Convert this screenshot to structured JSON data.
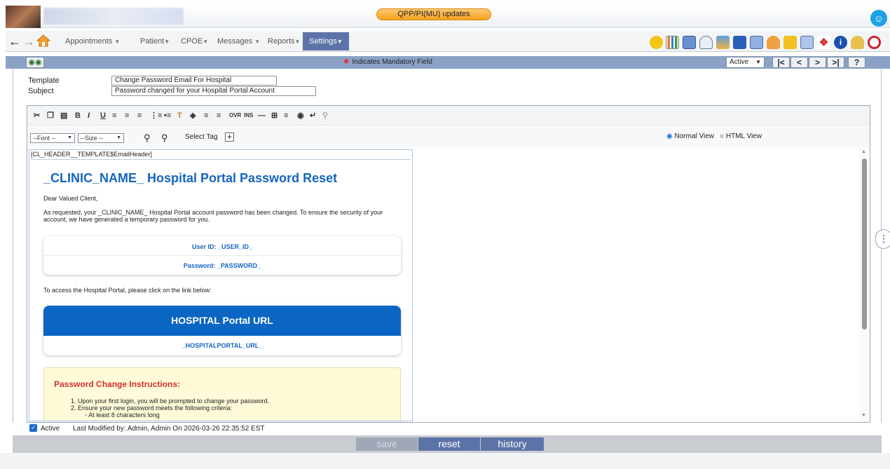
{
  "topbar": {
    "updates_label": "QPP/PI(MU) updates"
  },
  "nav": {
    "menus": [
      {
        "label": "Appointments"
      },
      {
        "label": "Patient"
      },
      {
        "label": "CPOE"
      },
      {
        "label": "Messages"
      },
      {
        "label": "Reports"
      }
    ],
    "settings_label": "Settings"
  },
  "header": {
    "mandatory_text": "Indicates Mandatory Field",
    "status_value": "Active",
    "nav_first": "|<",
    "nav_prev": "<",
    "nav_next": ">",
    "nav_last": ">|",
    "help": "?"
  },
  "form": {
    "template_label": "Template",
    "template_value": "Change Password Email For Hospital",
    "subject_label": "Subject",
    "subject_value": "Password changed for your Hospital Portal Account"
  },
  "editor": {
    "font_select": "--Font --",
    "size_select": "--Size --",
    "select_tag_label": "Select Tag",
    "normal_view_label": "Normal View",
    "html_view_label": "HTML View"
  },
  "email": {
    "header_tag": "[CL_HEADER__TEMPLATE$EmailHeader]",
    "title": "_CLINIC_NAME_ Hospital Portal Password Reset",
    "greeting": "Dear Valued Client,",
    "intro": "As requested, your _CLINIC_NAME_ Hospital Portal account password has been changed. To ensure the security of your account, we have generated a temporary password for you.",
    "user_id_line": "User ID: _USER_ID_",
    "password_line": "Password: _PASSWORD_",
    "access_text": "To access the Hospital Portal, please click on the link below:",
    "portal_button": "HOSPITAL Portal URL",
    "portal_url": "_HOSPITALPORTAL_URL_",
    "instructions_title": "Password Change Instructions:",
    "instruction_1": "1. Upon your first login, you will be prompted to change your password.",
    "instruction_2": "2. Ensure your new password meets the following criteria:",
    "criteria_1": "At least 8 characters long"
  },
  "footer": {
    "active_label": "Active",
    "last_modified": "Last Modified by: Admin, Admin On 2026-03-26 22:35:52 EST"
  },
  "buttons": {
    "save": "save",
    "reset": "reset",
    "history": "history"
  },
  "colors": {
    "accent": "#5b73a7",
    "link_blue": "#1565c0",
    "portal_blue": "#0a66c2",
    "instructions_red": "#d32f2f",
    "instructions_bg": "#fffbd9"
  }
}
